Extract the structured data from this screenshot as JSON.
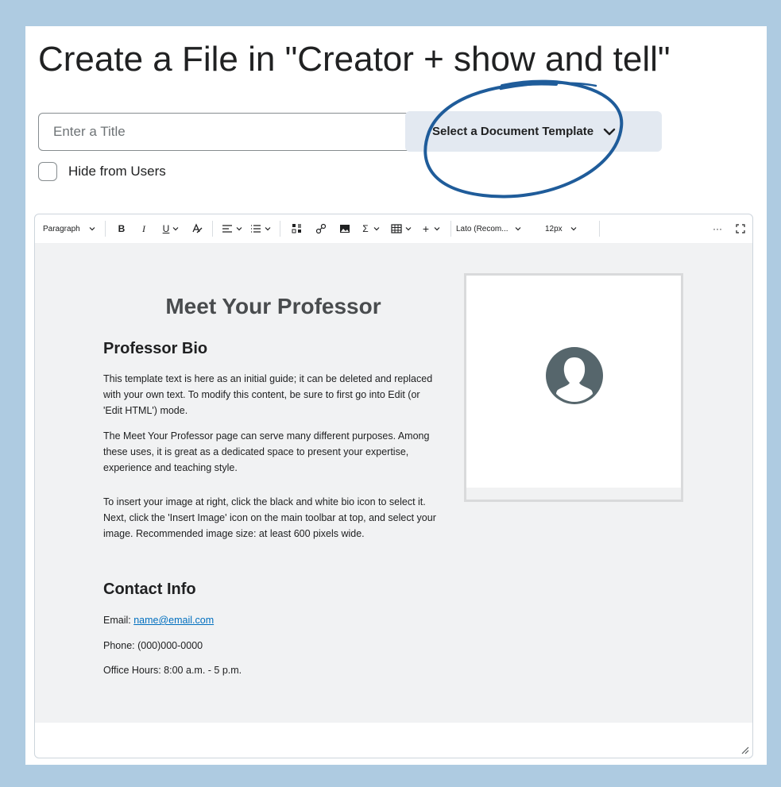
{
  "header": {
    "title": "Create a File in \"Creator + show and tell\""
  },
  "form": {
    "title_placeholder": "Enter a Title",
    "title_value": "",
    "template_button_label": "Select a Document Template",
    "hide_checkbox_label": "Hide from Users",
    "hide_checked": false
  },
  "toolbar": {
    "block_format": "Paragraph",
    "bold": "B",
    "italic": "I",
    "underline": "U",
    "sum": "Σ",
    "plus": "+",
    "font_family": "Lato (Recom...",
    "font_size": "12px",
    "more": "···"
  },
  "content": {
    "heading": "Meet Your Professor",
    "bio_heading": "Professor Bio",
    "bio_paragraphs": [
      "This template text is here as an initial guide; it can be deleted and replaced with your own text. To modify this content, be sure to first go into Edit (or 'Edit HTML') mode.",
      "The Meet Your Professor page can serve many different purposes. Among these uses, it is great as a dedicated space to present your expertise, experience and teaching style.",
      "To insert your image at right, click the black and white bio icon to select it. Next, click the 'Insert Image' icon  on the main toolbar at top, and select your image.  Recommended image size: at least 600 pixels wide."
    ],
    "contact_heading": "Contact Info",
    "email_label": "Email: ",
    "email_value": "name@email.com",
    "phone": "Phone: (000)000-0000",
    "office_hours": "Office Hours: 8:00 a.m. - 5 p.m."
  },
  "colors": {
    "page_background": "#aecbe1",
    "annotation_circle": "#1f5c9a",
    "template_button_bg": "#e3e9f1",
    "link": "#006fbf",
    "bio_icon": "#56666c"
  }
}
